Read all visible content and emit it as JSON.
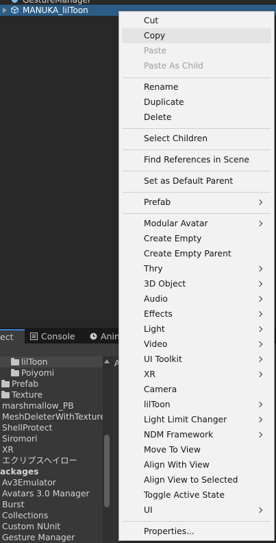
{
  "hierarchy": {
    "partial_item": "GestureManager",
    "selected_item": "MANUKA_lilToon"
  },
  "tabs": {
    "project_partial": "ect",
    "console": "Console",
    "animation_partial": "Anim"
  },
  "project": {
    "items": [
      "lilToon",
      "Poiyomi",
      "Prefab",
      "Texture",
      "marshmallow_PB",
      "MeshDeleterWithTexture",
      "ShellProtect",
      "Siromori",
      "XR",
      "エクリプスヘイロー",
      "ackages",
      "Av3Emulator",
      "Avatars 3.0 Manager",
      "Burst",
      "Collections",
      "Custom NUnit",
      "Gesture Manager"
    ],
    "right_partial": "A"
  },
  "context_menu": {
    "cut": "Cut",
    "copy": "Copy",
    "paste": "Paste",
    "paste_as_child": "Paste As Child",
    "rename": "Rename",
    "duplicate": "Duplicate",
    "delete": "Delete",
    "select_children": "Select Children",
    "find_references": "Find References in Scene",
    "set_default_parent": "Set as Default Parent",
    "prefab": "Prefab",
    "modular_avatar": "Modular Avatar",
    "create_empty": "Create Empty",
    "create_empty_parent": "Create Empty Parent",
    "thry": "Thry",
    "object_3d": "3D Object",
    "audio": "Audio",
    "effects": "Effects",
    "light": "Light",
    "video": "Video",
    "ui_toolkit": "UI Toolkit",
    "xr": "XR",
    "camera": "Camera",
    "liltoon": "lilToon",
    "light_limit_changer": "Light Limit Changer",
    "ndm_framework": "NDM Framework",
    "move_to_view": "Move To View",
    "align_with_view": "Align With View",
    "align_view_to_selected": "Align View to Selected",
    "toggle_active_state": "Toggle Active State",
    "ui": "UI",
    "properties": "Properties..."
  },
  "colors": {
    "selection": "#2c5d87",
    "menu_bg": "#f2f2f2",
    "cube_icon": "#7fb6e8"
  }
}
